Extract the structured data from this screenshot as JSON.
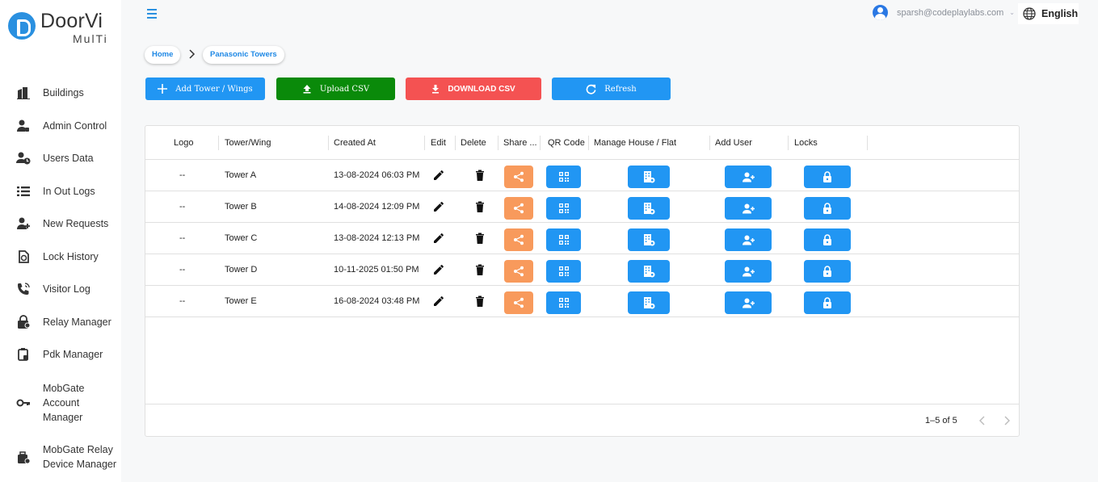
{
  "app": {
    "logo_main": "DoorVi",
    "logo_sub": "MulTi"
  },
  "sidebar": {
    "items": [
      {
        "label": "Buildings",
        "icon": "buildings-icon"
      },
      {
        "label": "Admin Control",
        "icon": "admin-icon"
      },
      {
        "label": "Users Data",
        "icon": "users-icon"
      },
      {
        "label": "In Out Logs",
        "icon": "list-icon"
      },
      {
        "label": "New Requests",
        "icon": "person-add-icon"
      },
      {
        "label": "Lock History",
        "icon": "history-icon"
      },
      {
        "label": "Visitor Log",
        "icon": "phone-icon"
      },
      {
        "label": "Relay Manager",
        "icon": "lock-gear-icon"
      },
      {
        "label": "Pdk Manager",
        "icon": "pdk-icon"
      },
      {
        "label": "MobGate Account Manager",
        "icon": "key-icon"
      },
      {
        "label": "MobGate Relay Device Manager",
        "icon": "device-clock-icon"
      }
    ]
  },
  "topbar": {
    "user_email": "sparsh@codeplaylabs.com",
    "language": "English"
  },
  "breadcrumb": {
    "home": "Home",
    "current": "Panasonic Towers"
  },
  "actions": {
    "add": "Add Tower / Wings",
    "upload": "Upload CSV",
    "download": "DOWNLOAD CSV",
    "refresh": "Refresh"
  },
  "table": {
    "columns": [
      "Logo",
      "Tower/Wing",
      "Created At",
      "Edit",
      "Delete",
      "Share ...",
      "QR Code",
      "Manage House / Flat",
      "Add User",
      "Locks"
    ],
    "rows": [
      {
        "logo": "--",
        "tower": "Tower A",
        "created": "13-08-2024 06:03 PM"
      },
      {
        "logo": "--",
        "tower": "Tower B",
        "created": "14-08-2024 12:09 PM"
      },
      {
        "logo": "--",
        "tower": "Tower C",
        "created": "13-08-2024 12:13 PM"
      },
      {
        "logo": "--",
        "tower": "Tower D",
        "created": "10-11-2025 01:50 PM"
      },
      {
        "logo": "--",
        "tower": "Tower E",
        "created": "16-08-2024 03:48 PM"
      }
    ],
    "pagination": "1–5 of 5"
  },
  "colors": {
    "primary": "#2196f3",
    "share": "#f89a5c",
    "upload": "#0a8a0a",
    "download": "#f45252"
  }
}
